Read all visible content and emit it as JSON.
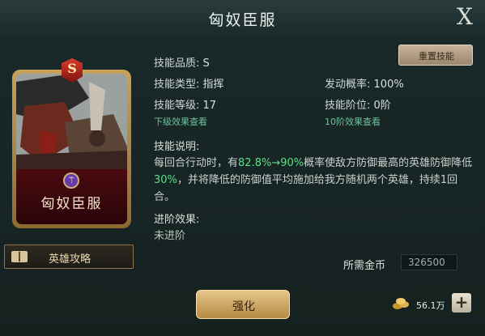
{
  "window": {
    "title": "匈奴臣服",
    "close_glyph": "X"
  },
  "card": {
    "name": "匈奴臣服",
    "grade": "S",
    "emblem_glyph": "⚚"
  },
  "buttons": {
    "reset": "重置技能",
    "guide": "英雄攻略",
    "upgrade": "强化"
  },
  "skill": {
    "quality_label": "技能品质:",
    "quality_value": "S",
    "type_label": "技能类型:",
    "type_value": "指挥",
    "rate_label": "发动概率:",
    "rate_value": "100%",
    "level_label": "技能等级:",
    "level_value": "17",
    "stage_label": "技能阶位:",
    "stage_value": "0阶",
    "lower_effect_link": "下级效果查看",
    "tenth_effect_link": "10阶效果查看"
  },
  "description": {
    "heading": "技能说明:",
    "part1": "每回合行动时，有",
    "value_from": "82.8%",
    "arrow": "→",
    "value_to": "90%",
    "part2": "概率使敌方防御最高的英雄防御降低",
    "value_reduce": "30%",
    "part3": "，并将降低的防御值平均施加给我方随机两个英雄，持续1回合。"
  },
  "advance": {
    "heading": "进阶效果:",
    "value": "未进阶"
  },
  "cost": {
    "label": "所需金币",
    "value": "326500"
  },
  "currency": {
    "amount": "56.1万",
    "add_glyph": "+"
  },
  "colors": {
    "highlight": "#5ee08a",
    "accent_gold": "#c9a25a"
  }
}
